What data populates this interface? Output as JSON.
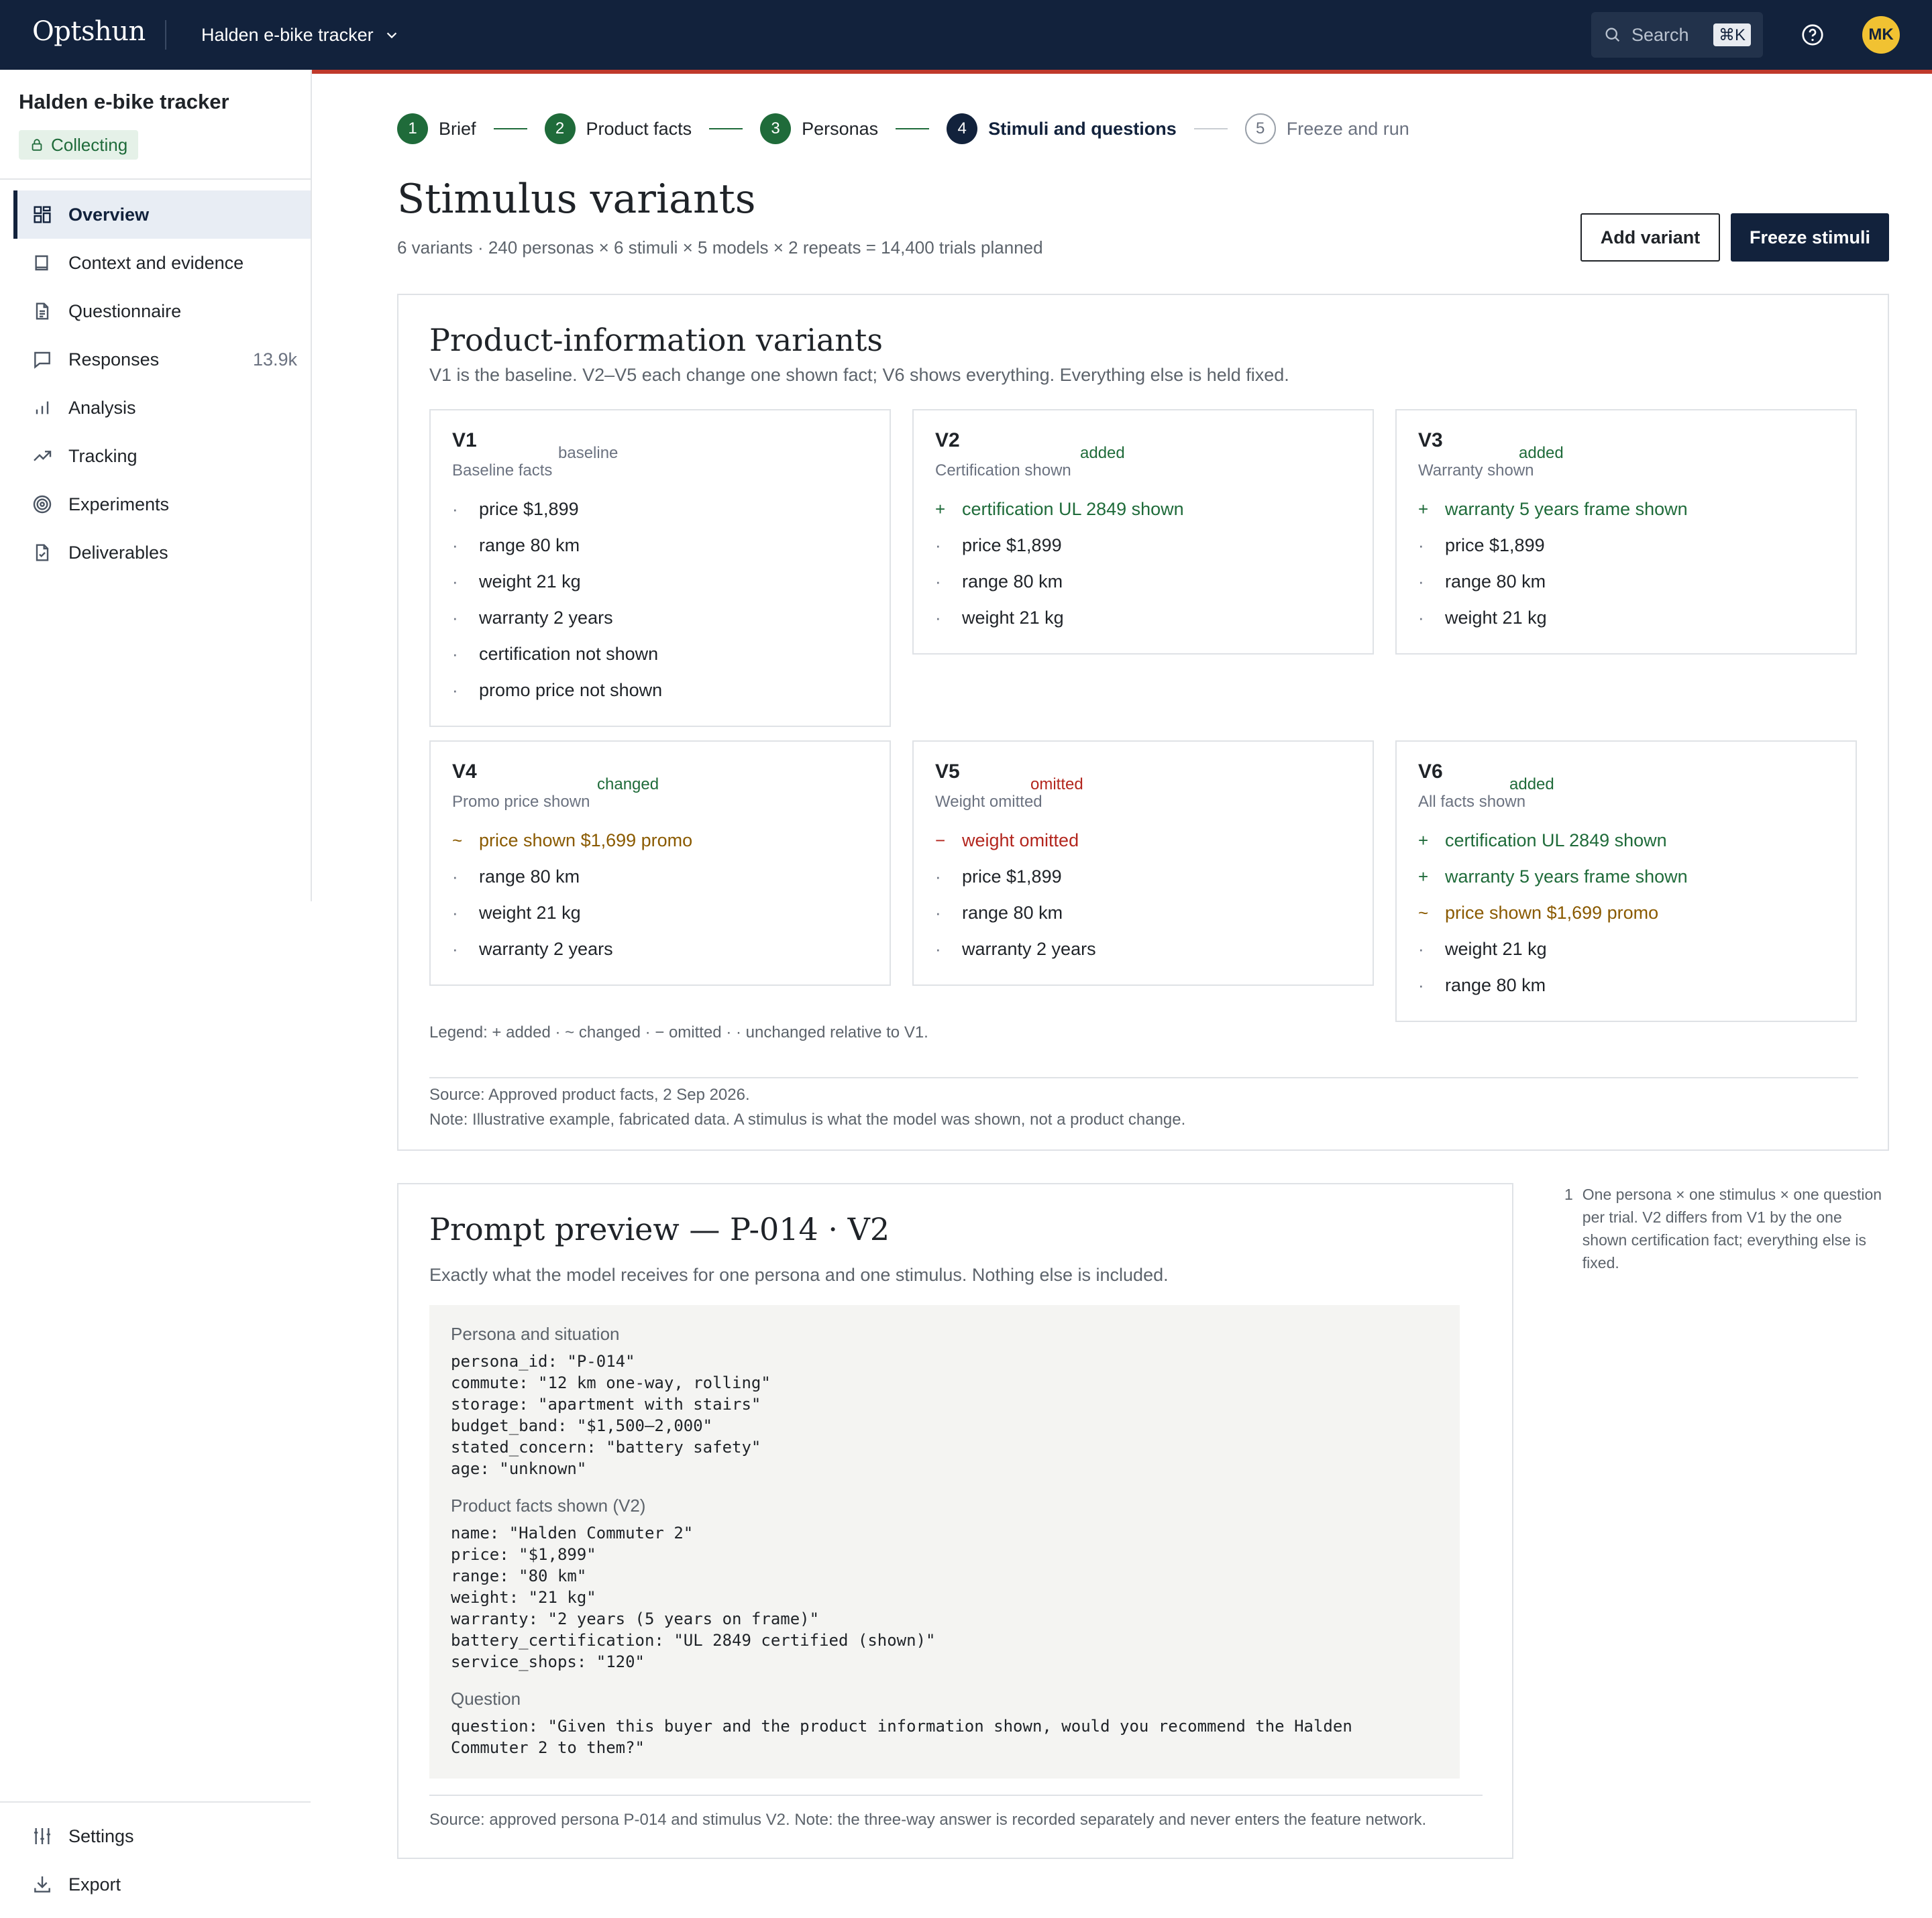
{
  "app": {
    "logo": "Optshun",
    "project_switch": "Halden e-bike tracker",
    "search_placeholder": "Search",
    "search_shortcut": "⌘K",
    "avatar_initials": "MK",
    "accent_color": "#12223c",
    "top_accent_color": "#c0392b"
  },
  "sidebar": {
    "project_name": "Halden e-bike tracker",
    "status": "Collecting",
    "items": [
      {
        "label": "Overview",
        "icon": "grid-icon",
        "active": true,
        "count": ""
      },
      {
        "label": "Context and evidence",
        "icon": "book-icon",
        "count": ""
      },
      {
        "label": "Questionnaire",
        "icon": "document-icon",
        "count": ""
      },
      {
        "label": "Responses",
        "icon": "chat-icon",
        "count": "13.9k"
      },
      {
        "label": "Analysis",
        "icon": "bar-chart-icon",
        "count": ""
      },
      {
        "label": "Tracking",
        "icon": "trend-icon",
        "count": ""
      },
      {
        "label": "Experiments",
        "icon": "target-icon",
        "count": ""
      },
      {
        "label": "Deliverables",
        "icon": "file-check-icon",
        "count": ""
      }
    ],
    "bottom": [
      {
        "label": "Settings",
        "icon": "sliders-icon"
      },
      {
        "label": "Export",
        "icon": "download-icon"
      }
    ]
  },
  "stepper": [
    {
      "num": "1",
      "label": "Brief",
      "state": "done"
    },
    {
      "num": "2",
      "label": "Product facts",
      "state": "done"
    },
    {
      "num": "3",
      "label": "Personas",
      "state": "done"
    },
    {
      "num": "4",
      "label": "Stimuli and questions",
      "state": "current"
    },
    {
      "num": "5",
      "label": "Freeze and run",
      "state": "todo"
    }
  ],
  "header": {
    "title": "Stimulus variants",
    "subtitle": "6 variants · 240 personas × 6 stimuli × 5 models × 2 repeats = 14,400 trials planned",
    "add_variant": "Add variant",
    "freeze": "Freeze stimuli"
  },
  "variants_card": {
    "title": "Product-information variants",
    "subtitle": "V1 is the baseline. V2–V5 each change one shown fact; V6 shows everything. Everything else is held fixed.",
    "variants": [
      {
        "id": "V1",
        "tag": "baseline",
        "name": "Baseline facts",
        "facts": [
          {
            "mark": "·",
            "text": "price $1,899",
            "kind": "unchanged"
          },
          {
            "mark": "·",
            "text": "range 80 km",
            "kind": "unchanged"
          },
          {
            "mark": "·",
            "text": "weight 21 kg",
            "kind": "unchanged"
          },
          {
            "mark": "·",
            "text": "warranty 2 years",
            "kind": "unchanged"
          },
          {
            "mark": "·",
            "text": "certification not shown",
            "kind": "unchanged"
          },
          {
            "mark": "·",
            "text": "promo price not shown",
            "kind": "unchanged"
          }
        ]
      },
      {
        "id": "V2",
        "tag": "added",
        "name": "Certification shown",
        "facts": [
          {
            "mark": "+",
            "text": "certification UL 2849 shown",
            "kind": "added"
          },
          {
            "mark": "·",
            "text": "price $1,899",
            "kind": "unchanged"
          },
          {
            "mark": "·",
            "text": "range 80 km",
            "kind": "unchanged"
          },
          {
            "mark": "·",
            "text": "weight 21 kg",
            "kind": "unchanged"
          }
        ]
      },
      {
        "id": "V3",
        "tag": "added",
        "name": "Warranty shown",
        "facts": [
          {
            "mark": "+",
            "text": "warranty 5 years frame shown",
            "kind": "added"
          },
          {
            "mark": "·",
            "text": "price $1,899",
            "kind": "unchanged"
          },
          {
            "mark": "·",
            "text": "range 80 km",
            "kind": "unchanged"
          },
          {
            "mark": "·",
            "text": "weight 21 kg",
            "kind": "unchanged"
          }
        ]
      },
      {
        "id": "V4",
        "tag": "changed",
        "name": "Promo price shown",
        "facts": [
          {
            "mark": "~",
            "text": "price shown $1,699 promo",
            "kind": "changed"
          },
          {
            "mark": "·",
            "text": "range 80 km",
            "kind": "unchanged"
          },
          {
            "mark": "·",
            "text": "weight 21 kg",
            "kind": "unchanged"
          },
          {
            "mark": "·",
            "text": "warranty 2 years",
            "kind": "unchanged"
          }
        ]
      },
      {
        "id": "V5",
        "tag": "omitted",
        "name": "Weight omitted",
        "facts": [
          {
            "mark": "−",
            "text": "weight omitted",
            "kind": "omitted"
          },
          {
            "mark": "·",
            "text": "price $1,899",
            "kind": "unchanged"
          },
          {
            "mark": "·",
            "text": "range 80 km",
            "kind": "unchanged"
          },
          {
            "mark": "·",
            "text": "warranty 2 years",
            "kind": "unchanged"
          }
        ]
      },
      {
        "id": "V6",
        "tag": "added",
        "name": "All facts shown",
        "facts": [
          {
            "mark": "+",
            "text": "certification UL 2849 shown",
            "kind": "added"
          },
          {
            "mark": "+",
            "text": "warranty 5 years frame shown",
            "kind": "added"
          },
          {
            "mark": "~",
            "text": "price shown $1,699 promo",
            "kind": "changed"
          },
          {
            "mark": "·",
            "text": "weight 21 kg",
            "kind": "unchanged"
          },
          {
            "mark": "·",
            "text": "range 80 km",
            "kind": "unchanged"
          }
        ]
      }
    ],
    "legend": "Legend: + added · ~ changed · − omitted · · unchanged relative to V1.",
    "source": "Source: Approved product facts, 2 Sep 2026.",
    "note": "Note: Illustrative example, fabricated data. A stimulus is what the model was shown, not a product change."
  },
  "prompt_card": {
    "title": "Prompt preview — P-014 · V2",
    "subtitle": "Exactly what the model receives for one persona and one stimulus. Nothing else is included.",
    "sections": [
      {
        "heading": "Persona and situation",
        "code": "persona_id: \"P-014\"\ncommute: \"12 km one-way, rolling\"\nstorage: \"apartment with stairs\"\nbudget_band: \"$1,500–2,000\"\nstated_concern: \"battery safety\"\nage: \"unknown\""
      },
      {
        "heading": "Product facts shown (V2)",
        "code": "name: \"Halden Commuter 2\"\nprice: \"$1,899\"\nrange: \"80 km\"\nweight: \"21 kg\"\nwarranty: \"2 years (5 years on frame)\"\nbattery_certification: \"UL 2849 certified (shown)\"\nservice_shops: \"120\""
      },
      {
        "heading": "Question",
        "code": "question: \"Given this buyer and the product information shown, would you recommend the Halden\nCommuter 2 to them?\""
      }
    ],
    "source": "Source: approved persona P-014 and stimulus V2. Note: the three-way answer is recorded separately and never enters the feature network."
  },
  "footnote": {
    "num": "1",
    "text": "One persona × one stimulus × one question per trial. V2 differs from V1 by the one shown certification fact; everything else is fixed."
  }
}
